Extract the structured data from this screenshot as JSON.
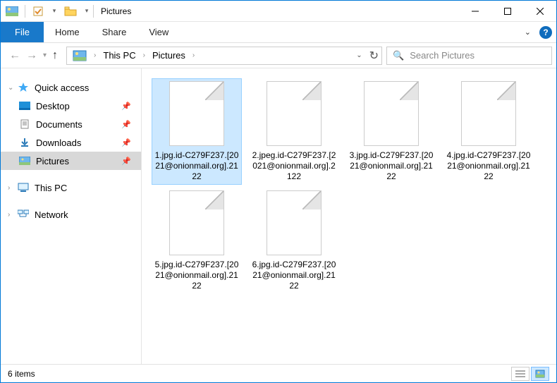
{
  "window": {
    "title": "Pictures"
  },
  "menu": {
    "file": "File",
    "home": "Home",
    "share": "Share",
    "view": "View"
  },
  "breadcrumb": {
    "thispc": "This PC",
    "current": "Pictures"
  },
  "search": {
    "placeholder": "Search Pictures"
  },
  "sidebar": {
    "quick_access": "Quick access",
    "items": [
      {
        "label": "Desktop"
      },
      {
        "label": "Documents"
      },
      {
        "label": "Downloads"
      },
      {
        "label": "Pictures"
      }
    ],
    "thispc": "This PC",
    "network": "Network"
  },
  "files": [
    {
      "name": "1.jpg.id-C279F237.[2021@onionmail.org].2122"
    },
    {
      "name": "2.jpeg.id-C279F237.[2021@onionmail.org].2122"
    },
    {
      "name": "3.jpg.id-C279F237.[2021@onionmail.org].2122"
    },
    {
      "name": "4.jpg.id-C279F237.[2021@onionmail.org].2122"
    },
    {
      "name": "5.jpg.id-C279F237.[2021@onionmail.org].2122"
    },
    {
      "name": "6.jpg.id-C279F237.[2021@onionmail.org].2122"
    }
  ],
  "status": {
    "text": "6 items"
  }
}
